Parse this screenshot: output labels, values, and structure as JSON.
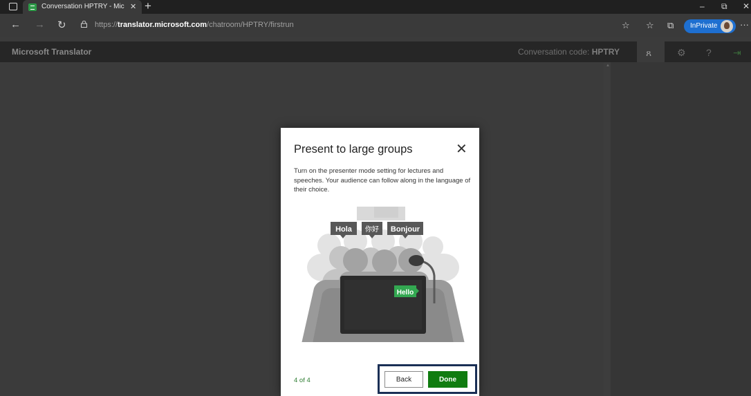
{
  "browser": {
    "tab_title": "Conversation HPTRY - Microsoft",
    "tab_close": "✕",
    "new_tab": "+",
    "url_prefix": "https://",
    "url_domain": "translator.microsoft.com",
    "url_path": "/chatroom/HPTRY/firstrun",
    "inprivate_label": "InPrivate",
    "window_controls": {
      "minimize": "–",
      "restore": "⧉",
      "close": "✕"
    }
  },
  "app": {
    "brand": "Microsoft Translator",
    "conversation_code_label": "Conversation code:",
    "conversation_code": "HPTRY"
  },
  "modal": {
    "title": "Present to large groups",
    "close": "✕",
    "description": "Turn on the presenter mode setting for lectures and speeches. Your audience can follow along in the language of their choice.",
    "bubbles": [
      "Hola",
      "你好",
      "Bonjour"
    ],
    "screen_bubble": "Hello",
    "page_count": "4 of 4",
    "back_label": "Back",
    "done_label": "Done"
  },
  "colors": {
    "accent_green": "#107c10",
    "inprivate_blue": "#1e6fd0",
    "focus_outline": "#1a2f55"
  }
}
